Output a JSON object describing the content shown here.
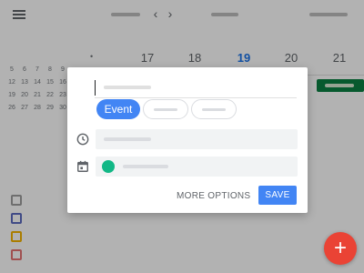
{
  "app": {
    "nav": {
      "prev_icon": "chevron-left-icon",
      "next_icon": "chevron-right-icon",
      "prev_glyph": "‹",
      "next_glyph": "›"
    },
    "days": [
      {
        "num": "17",
        "today": false
      },
      {
        "num": "18",
        "today": false
      },
      {
        "num": "19",
        "today": true
      },
      {
        "num": "20",
        "today": false
      },
      {
        "num": "21",
        "today": false
      }
    ],
    "mini_calendar": [
      [
        "5",
        "6",
        "7",
        "8",
        "9"
      ],
      [
        "12",
        "13",
        "14",
        "15",
        "16"
      ],
      [
        "19",
        "20",
        "21",
        "22",
        "23"
      ],
      [
        "26",
        "27",
        "28",
        "29",
        "30"
      ]
    ],
    "calendar_colors": [
      "#9e9e9e",
      "#5c6bc0",
      "#f4b400",
      "#e57373"
    ],
    "fab_icon": "plus-icon",
    "fab_glyph": "+"
  },
  "dialog": {
    "title_value": "",
    "chips": [
      {
        "label": "Event",
        "active": true
      },
      {
        "label": "",
        "active": false
      },
      {
        "label": "",
        "active": false
      }
    ],
    "time_icon": "clock-icon",
    "calendar_icon": "calendar-icon",
    "calendar_color": "#12b886",
    "more_options_label": "MORE OPTIONS",
    "save_label": "SAVE"
  },
  "colors": {
    "accent": "#4285f4",
    "fab": "#ea4335",
    "today": "#1a73e8"
  }
}
